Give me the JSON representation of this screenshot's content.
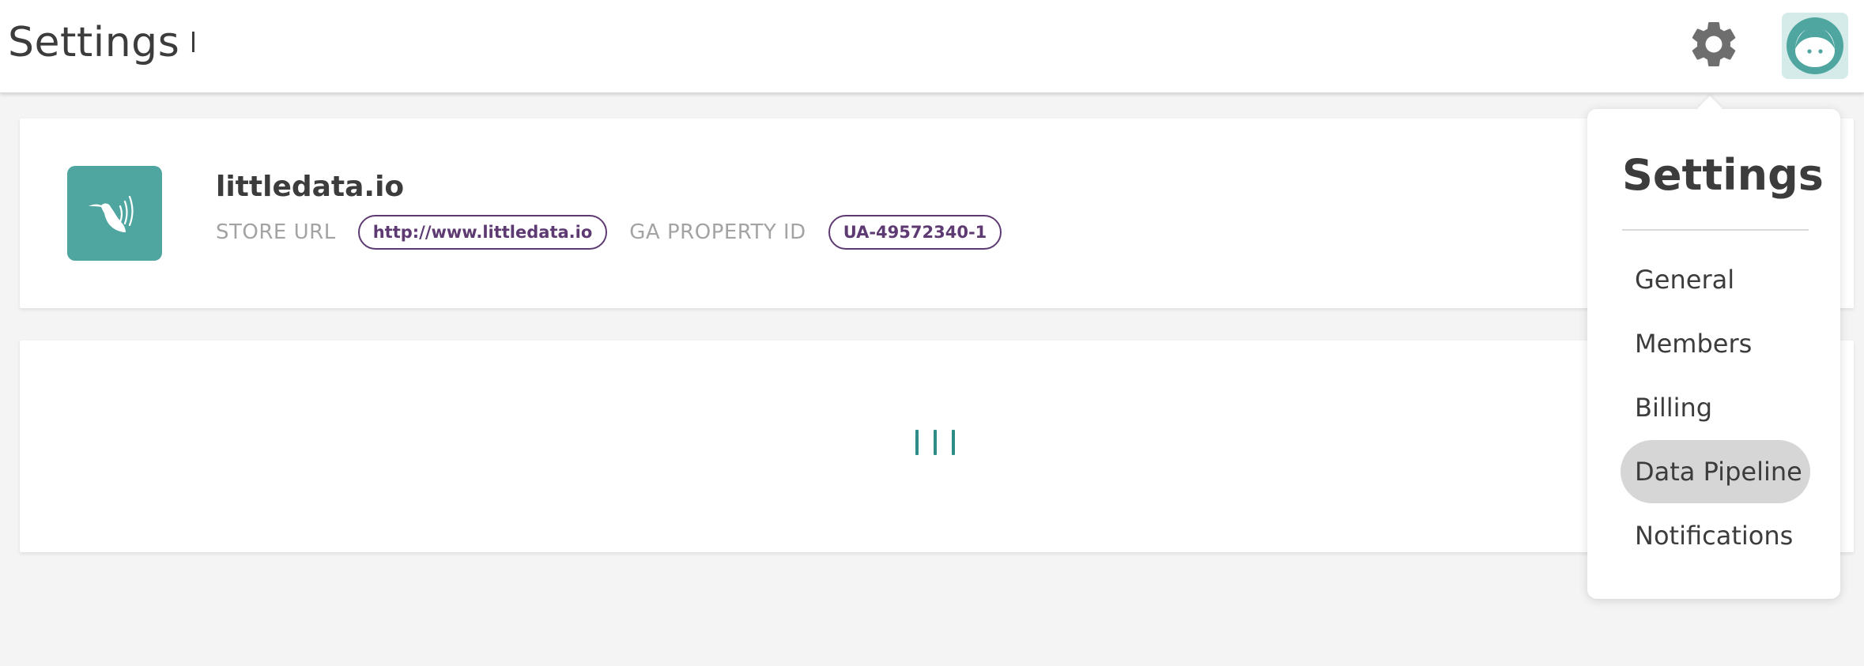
{
  "header": {
    "title": "Settings",
    "settings_icon": "gear-icon",
    "avatar_icon": "user-face-icon"
  },
  "store": {
    "name": "littledata.io",
    "store_url_label": "STORE URL",
    "store_url_value": "http://www.littledata.io",
    "ga_property_label": "GA PROPERTY ID",
    "ga_property_value": "UA-49572340-1",
    "logo_icon": "hummingbird-icon"
  },
  "loading": {
    "icon": "loading-bars-icon"
  },
  "settings_menu": {
    "title": "Settings",
    "items": [
      {
        "label": "General"
      },
      {
        "label": "Members"
      },
      {
        "label": "Billing"
      },
      {
        "label": "Data Pipeline",
        "active": true
      },
      {
        "label": "Notifications"
      }
    ]
  },
  "colors": {
    "accent": "#4fa6a0",
    "pill": "#5e3a72",
    "avatar_bg": "#d5ebe9",
    "active_item_bg": "#d6d6d6"
  }
}
